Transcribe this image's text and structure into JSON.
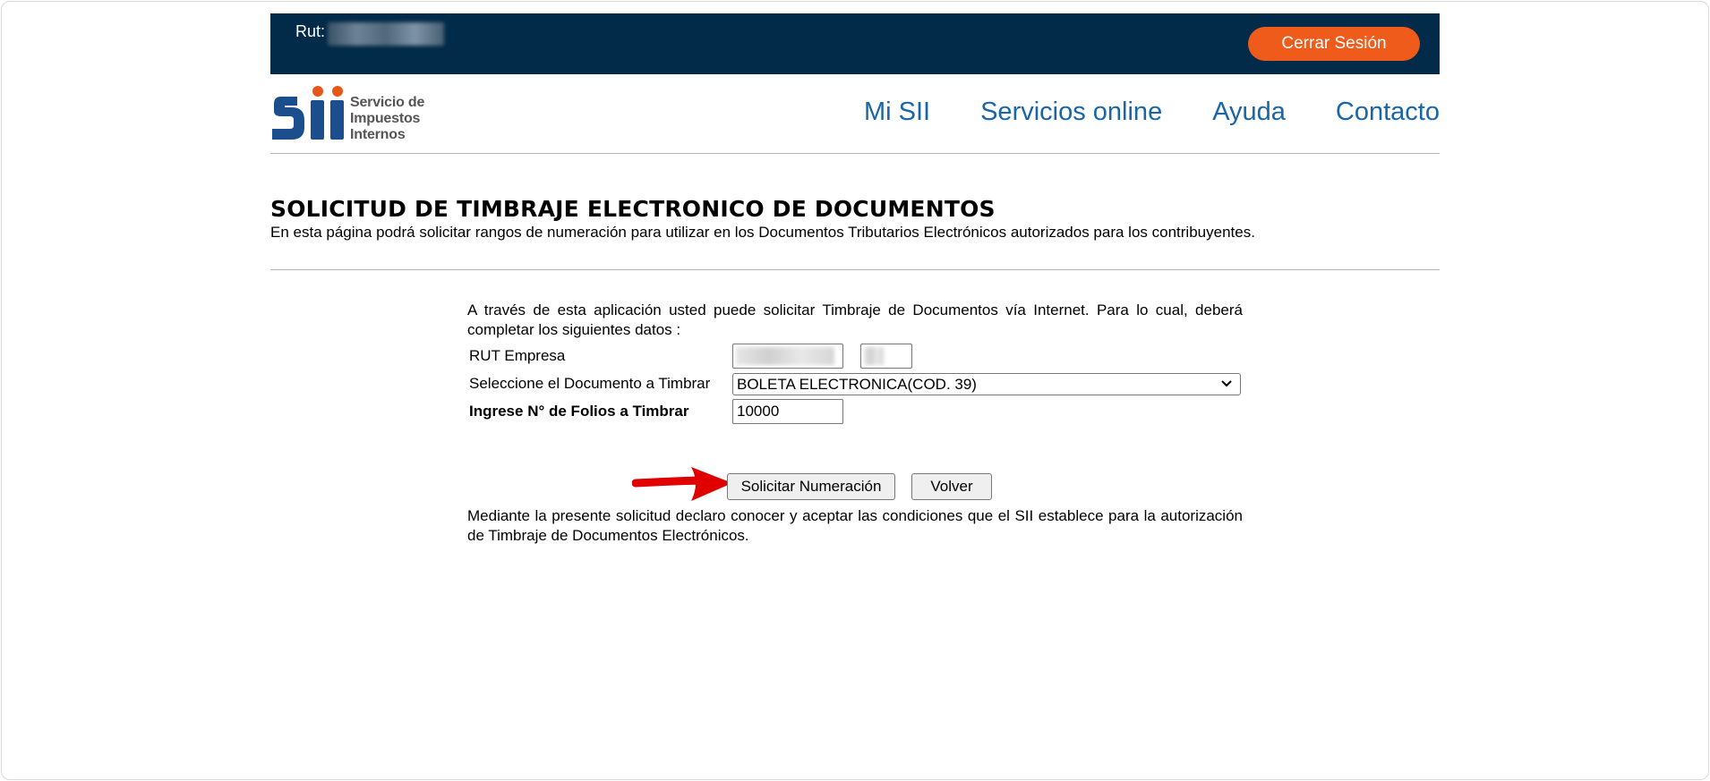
{
  "topbar": {
    "rut_label": "Rut:",
    "logout_label": "Cerrar Sesión"
  },
  "header": {
    "logo_text": [
      "Servicio de",
      "Impuestos",
      "Internos"
    ],
    "nav": [
      "Mi SII",
      "Servicios online",
      "Ayuda",
      "Contacto"
    ]
  },
  "page": {
    "title": "SOLICITUD DE TIMBRAJE ELECTRONICO DE DOCUMENTOS",
    "subtitle": "En esta página podrá solicitar rangos de numeración para utilizar en los Documentos Tributarios Electrónicos autorizados para los contribuyentes."
  },
  "form": {
    "intro": "A través de esta aplicación usted puede solicitar Timbraje de Documentos vía Internet. Para lo cual, deberá completar los siguientes datos :",
    "rut_label": "RUT Empresa",
    "doc_label": "Seleccione el Documento a Timbrar",
    "doc_selected": "BOLETA ELECTRONICA(COD. 39)",
    "folios_label": "Ingrese N° de Folios a Timbrar",
    "folios_value": "10000",
    "submit_label": "Solicitar Numeración",
    "back_label": "Volver",
    "outro": "Mediante la presente solicitud declaro conocer y aceptar las condiciones que el SII establece para la autorización de Timbraje de Documentos Electrónicos."
  },
  "colors": {
    "topbar_bg": "#022b49",
    "logout_bg": "#ef5b1b",
    "nav_link": "#1965a8",
    "arrow": "#e00000"
  },
  "icons": {
    "logo": "sii-logo",
    "dropdown": "chevron-down-icon",
    "annotation": "red-arrow-icon"
  }
}
